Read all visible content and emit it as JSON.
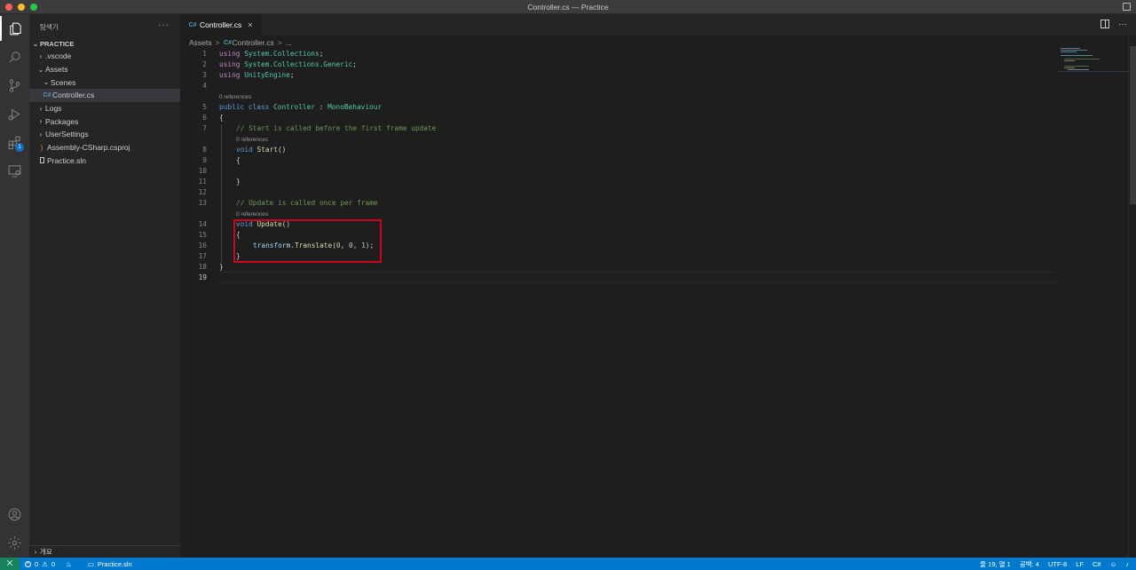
{
  "window": {
    "title": "Controller.cs — Practice"
  },
  "activity_bar": {
    "extensions_badge": "1"
  },
  "sidebar": {
    "header": "탐색기",
    "more": "···",
    "section": "PRACTICE",
    "tree": [
      {
        "label": ".vscode",
        "chevron": "›",
        "depth": 1
      },
      {
        "label": "Assets",
        "chevron": "⌄",
        "depth": 1
      },
      {
        "label": "Scenes",
        "chevron": "⌄",
        "depth": 2
      },
      {
        "label": "Controller.cs",
        "icon": "C#",
        "depth": 2,
        "selected": true
      },
      {
        "label": "Logs",
        "chevron": "›",
        "depth": 1
      },
      {
        "label": "Packages",
        "chevron": "›",
        "depth": 1
      },
      {
        "label": "UserSettings",
        "chevron": "›",
        "depth": 1
      },
      {
        "label": "Assembly-CSharp.csproj",
        "icon": "rss",
        "depth": 1
      },
      {
        "label": "Practice.sln",
        "icon": "sln",
        "depth": 1
      }
    ],
    "outline": "개요"
  },
  "tabs": [
    {
      "label": "Controller.cs",
      "icon": "C#",
      "close": "×"
    }
  ],
  "tab_actions": {
    "more": "···"
  },
  "breadcrumb": {
    "folder": "Assets",
    "file": "Controller.cs",
    "more": "...",
    "sep": ">"
  },
  "code": {
    "line_numbers": [
      "1",
      "2",
      "3",
      "4",
      "5",
      "6",
      "7",
      "8",
      "9",
      "10",
      "11",
      "12",
      "13",
      "14",
      "15",
      "16",
      "17",
      "18",
      "19"
    ],
    "lens_text": "0 references",
    "lines": {
      "l1_kw": "using",
      "l1_ns": "System.Collections",
      "l1_end": ";",
      "l2_kw": "using",
      "l2_ns": "System.Collections.Generic",
      "l2_end": ";",
      "l3_kw": "using",
      "l3_ns": "UnityEngine",
      "l3_end": ";",
      "l5_public": "public",
      "l5_class": "class",
      "l5_name": "Controller",
      "l5_colon": " : ",
      "l5_base": "MonoBehaviour",
      "l6": "{",
      "l7": "// Start is called before the first frame update",
      "l8_kw": "void",
      "l8_fn": "Start",
      "l8_paren": "()",
      "l9": "{",
      "l11": "}",
      "l13": "// Update is called once per frame",
      "l14_kw": "void",
      "l14_fn": "Update",
      "l14_paren": "()",
      "l15": "{",
      "l16_var": "transform",
      "l16_dot": ".",
      "l16_fn": "Translate",
      "l16_open": "(",
      "l16_n1": "0",
      "l16_c1": ", ",
      "l16_n2": "0",
      "l16_c2": ", ",
      "l16_n3": "1",
      "l16_close": ");",
      "l17": "}",
      "l18": "}"
    }
  },
  "statusbar": {
    "remote": "⨉",
    "errors": "0",
    "warnings": "0",
    "solution": "Practice.sln",
    "position": "줄 19, 열 1",
    "spaces": "공백: 4",
    "encoding": "UTF-8",
    "eol": "LF",
    "language": "C#"
  },
  "colors": {
    "statusbar": "#007acc",
    "highlight_box": "#d0021b",
    "keyword": "#569cd6",
    "type": "#4ec9b0",
    "comment": "#6a9955"
  }
}
